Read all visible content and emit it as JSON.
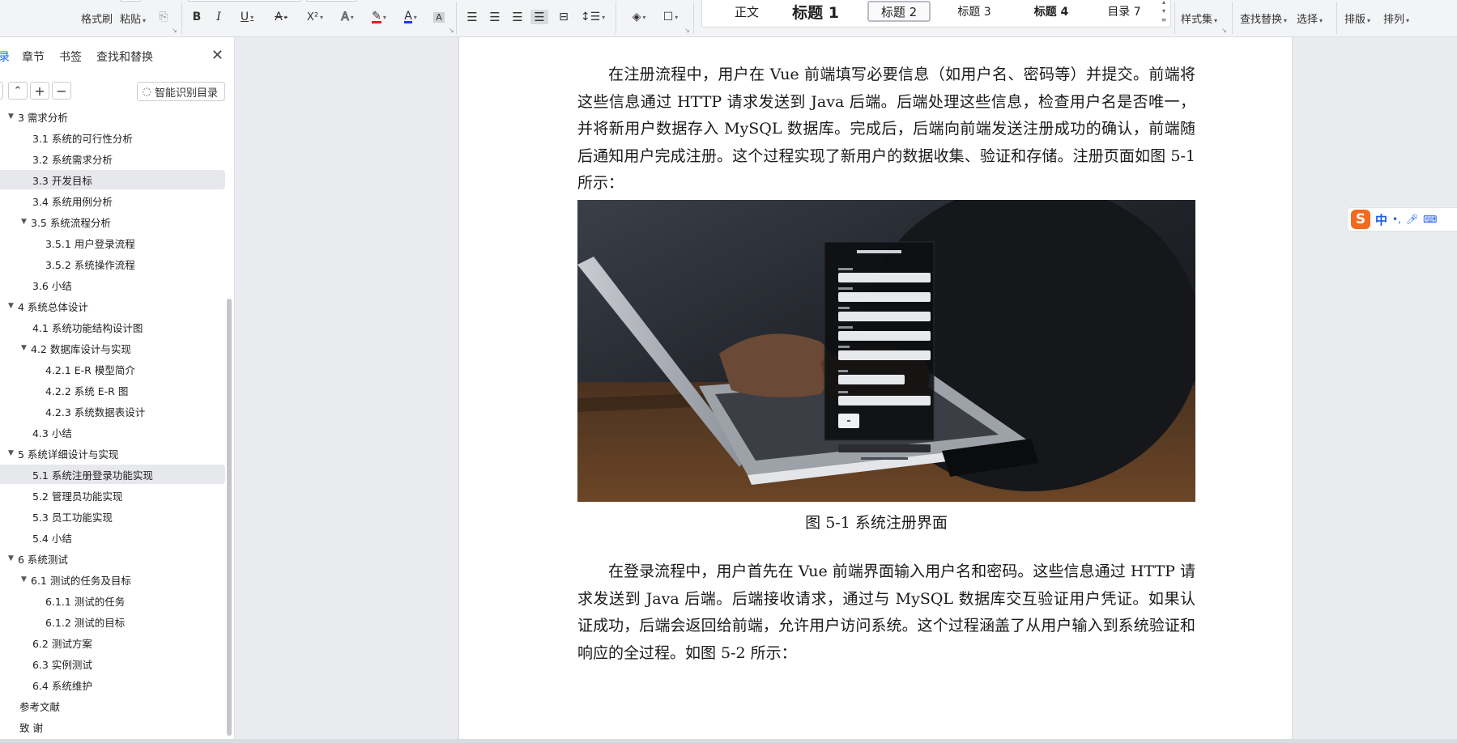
{
  "ribbon": {
    "clipboard": {
      "format_painter": "格式刷",
      "paste": "粘贴"
    },
    "style_samples": [
      {
        "label": "正文"
      },
      {
        "label": "标题 1"
      },
      {
        "label": "标题 2"
      },
      {
        "label": "标题 3"
      },
      {
        "label": "标题 4"
      },
      {
        "label": "目录 7"
      }
    ],
    "right_tools": {
      "style_set": "样式集",
      "find_replace": "查找替换",
      "select": "选择",
      "layout": "排版",
      "arrange": "排列"
    },
    "font_buttons": {
      "bold": "B",
      "italic": "I",
      "underline": "U",
      "strike": "A",
      "superscript": "X²",
      "text_effect": "A",
      "highlight": "A",
      "font_color": "A",
      "char_shading": "A"
    }
  },
  "nav": {
    "tabs": [
      "录",
      "章节",
      "书签",
      "查找和替换"
    ],
    "smart_toc": "智能识别目录",
    "toc": [
      {
        "label": "3  需求分析",
        "level": 0,
        "expanded": true
      },
      {
        "label": "3.1 系统的可行性分析",
        "level": 1
      },
      {
        "label": "3.2 系统需求分析",
        "level": 1
      },
      {
        "label": "3.3 开发目标",
        "level": 1,
        "selected": true
      },
      {
        "label": "3.4  系统用例分析",
        "level": 1
      },
      {
        "label": "3.5 系统流程分析",
        "level": 1,
        "expanded": true
      },
      {
        "label": "3.5.1  用户登录流程",
        "level": 2
      },
      {
        "label": "3.5.2  系统操作流程",
        "level": 2
      },
      {
        "label": "3.6 小结",
        "level": 1
      },
      {
        "label": "4  系统总体设计",
        "level": 0,
        "expanded": true
      },
      {
        "label": "4.1 系统功能结构设计图",
        "level": 1
      },
      {
        "label": "4.2  数据库设计与实现",
        "level": 1,
        "expanded": true
      },
      {
        "label": "4.2.1    E-R 模型简介",
        "level": 2
      },
      {
        "label": "4.2.2    系统 E-R 图",
        "level": 2
      },
      {
        "label": "4.2.3  系统数据表设计",
        "level": 2
      },
      {
        "label": "4.3 小结",
        "level": 1
      },
      {
        "label": "5  系统详细设计与实现",
        "level": 0,
        "expanded": true
      },
      {
        "label": "5.1 系统注册登录功能实现",
        "level": 1,
        "current": true
      },
      {
        "label": "5.2 管理员功能实现",
        "level": 1
      },
      {
        "label": "5.3 员工功能实现",
        "level": 1
      },
      {
        "label": "5.4  小结",
        "level": 1
      },
      {
        "label": "6  系统测试",
        "level": 0,
        "expanded": true
      },
      {
        "label": "6.1  测试的任务及目标",
        "level": 1,
        "expanded": true
      },
      {
        "label": "6.1.1    测试的任务",
        "level": 2
      },
      {
        "label": "6.1.2    测试的目标",
        "level": 2
      },
      {
        "label": "6.2    测试方案",
        "level": 1
      },
      {
        "label": "6.3    实例测试",
        "level": 1
      },
      {
        "label": "6.4    系统维护",
        "level": 1
      },
      {
        "label": "参考文献",
        "level": 0
      },
      {
        "label": "致  谢",
        "level": 0
      }
    ]
  },
  "document": {
    "para1": "在注册流程中，用户在 Vue 前端填写必要信息（如用户名、密码等）并提交。前端将这些信息通过 HTTP 请求发送到 Java 后端。后端处理这些信息，检查用户名是否唯一，并将新用户数据存入 MySQL 数据库。完成后，后端向前端发送注册成功的确认，前端随后通知用户完成注册。这个过程实现了新用户的数据收集、验证和存储。注册页面如图 5-1 所示：",
    "figure_caption": "图 5-1  系统注册界面",
    "para2": "在登录流程中，用户首先在 Vue 前端界面输入用户名和密码。这些信息通过 HTTP 请求发送到 Java 后端。后端接收请求，通过与 MySQL 数据库交互验证用户凭证。如果认证成功，后端会返回给前端，允许用户访问系统。这个过程涵盖了从用户输入到系统验证和响应的全过程。如图 5-2 所示："
  },
  "ime": {
    "logo": "S",
    "mode": "中"
  },
  "colors": {
    "accent": "#1a6ae6",
    "selection": "#e7e8eb",
    "page": "#ffffff",
    "canvas": "#e9ebef"
  }
}
